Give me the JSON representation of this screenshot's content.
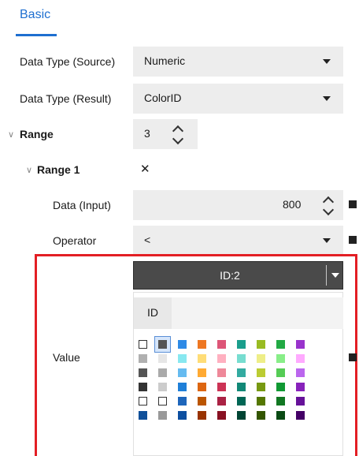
{
  "tab": {
    "label": "Basic"
  },
  "rows": {
    "source": {
      "label": "Data Type (Source)",
      "value": "Numeric"
    },
    "result": {
      "label": "Data Type (Result)",
      "value": "ColorID"
    },
    "range": {
      "label": "Range",
      "value": "3"
    },
    "range1": {
      "label": "Range 1",
      "remove_glyph": "✕"
    },
    "input": {
      "label": "Data (Input)",
      "value": "800"
    },
    "operator": {
      "label": "Operator",
      "value": "<"
    },
    "value": {
      "label": "Value"
    }
  },
  "color_picker": {
    "selected": "ID:2",
    "tab_label": "ID",
    "grid": [
      [
        "#ffffff",
        "#555555",
        "#2e8ae6",
        "#ee7722",
        "#dd5577",
        "#1a9e8c",
        "#99bb22",
        "#22aa44",
        "#9933cc"
      ],
      [
        "#b0b0b0",
        "#e6e6e6",
        "#88e8f0",
        "#ffdd77",
        "#ffb0c0",
        "#77ddd0",
        "#eeee88",
        "#88ee88",
        "#ffaaff"
      ],
      [
        "#555555",
        "#aaaaaa",
        "#66bbf0",
        "#ffaa33",
        "#ee8899",
        "#33aaa0",
        "#bbcc33",
        "#55cc55",
        "#bb66ee"
      ],
      [
        "#333333",
        "#cccccc",
        "#1f7fd8",
        "#dd6611",
        "#cc3355",
        "#118877",
        "#779911",
        "#119933",
        "#8822bb"
      ],
      [
        "#ffffff",
        "#ffffff",
        "#1e66bb",
        "#bb5500",
        "#aa2244",
        "#006655",
        "#557700",
        "#117722",
        "#661199"
      ],
      [
        "#0f4f99",
        "#999999",
        "#0d4fa0",
        "#993300",
        "#881122",
        "#004433",
        "#335500",
        "#0a4a14",
        "#440066"
      ]
    ]
  }
}
